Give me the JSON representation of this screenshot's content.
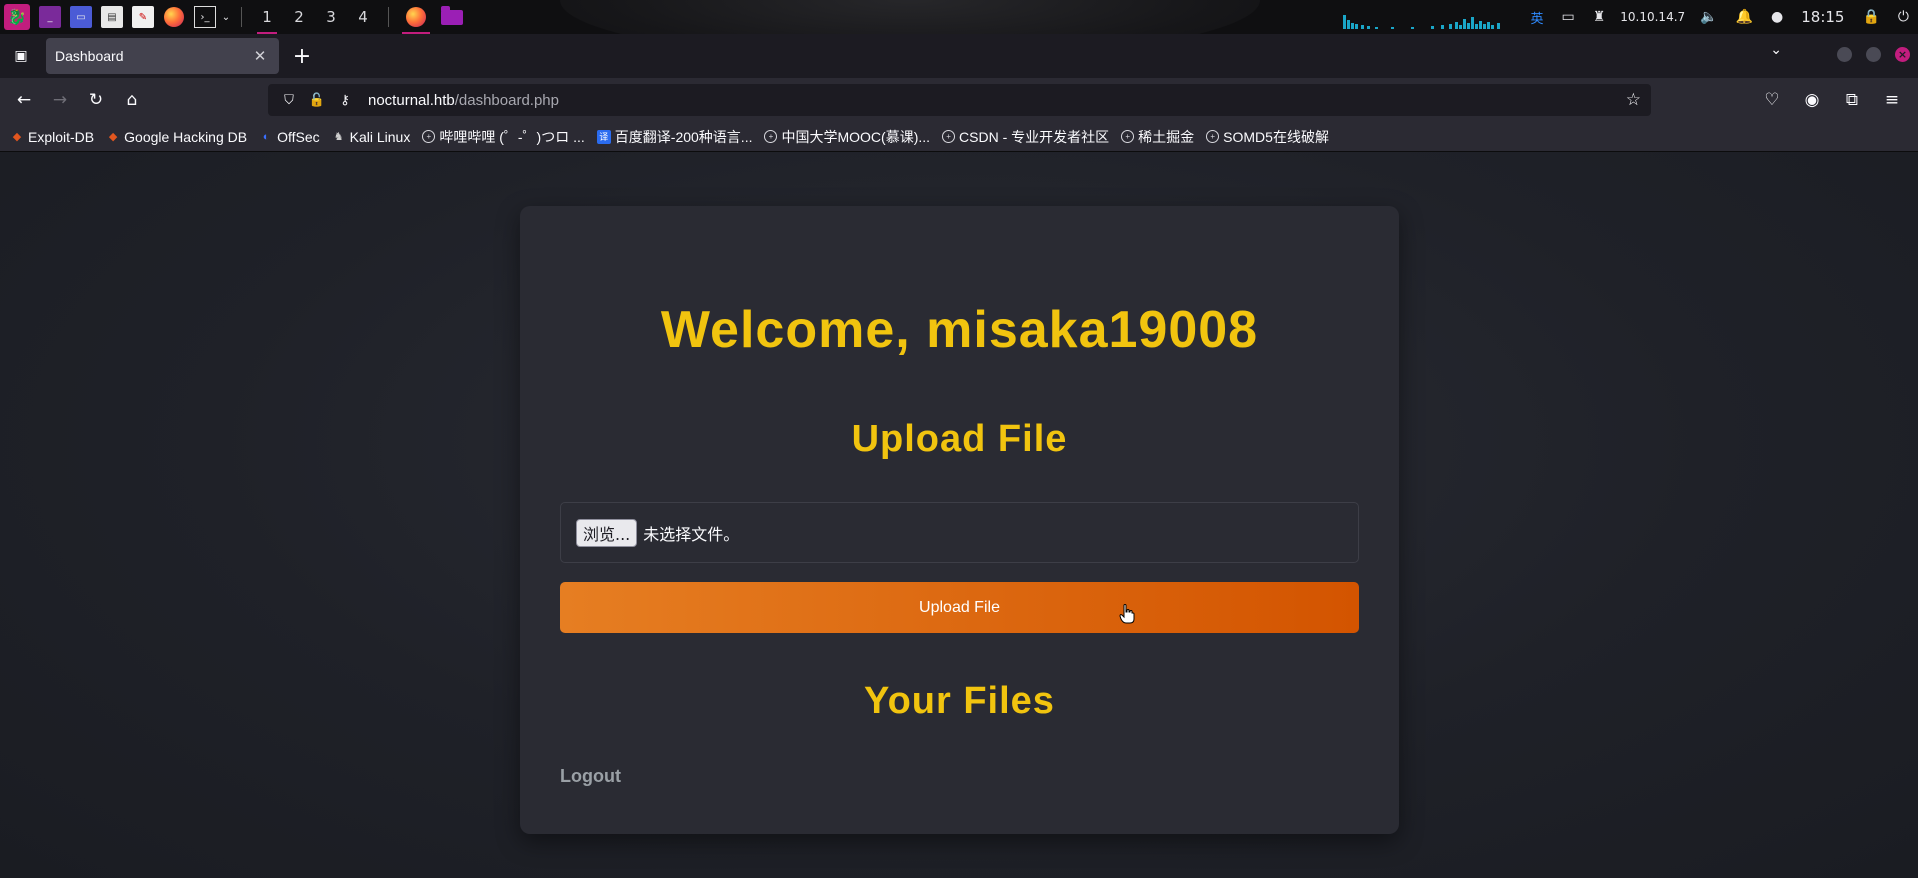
{
  "taskbar": {
    "workspaces": [
      "1",
      "2",
      "3",
      "4"
    ],
    "active_workspace": "1",
    "language": "英",
    "ip": "10.10.14.7",
    "clock": "18:15",
    "accent_color": "#c21d7e"
  },
  "browser": {
    "tab_title": "Dashboard",
    "url_host": "nocturnal.htb",
    "url_path": "/dashboard.php",
    "bookmarks": [
      {
        "label": "Exploit-DB",
        "icon": "flame-icon"
      },
      {
        "label": "Google Hacking DB",
        "icon": "flame-icon"
      },
      {
        "label": "OffSec",
        "icon": "offsec-icon"
      },
      {
        "label": "Kali Linux",
        "icon": "kali-icon"
      },
      {
        "label": "哔哩哔哩 (゜-゜)つロ ...",
        "icon": "globe-icon"
      },
      {
        "label": "百度翻译-200种语言...",
        "icon": "translate-icon"
      },
      {
        "label": "中国大学MOOC(慕课)...",
        "icon": "globe-icon"
      },
      {
        "label": "CSDN - 专业开发者社区",
        "icon": "globe-icon"
      },
      {
        "label": "稀土掘金",
        "icon": "globe-icon"
      },
      {
        "label": "SOMD5在线破解",
        "icon": "globe-icon"
      }
    ]
  },
  "page": {
    "welcome": "Welcome, misaka19008",
    "upload_heading": "Upload File",
    "browse_label": "浏览...",
    "no_file_text": "未选择文件。",
    "upload_button": "Upload File",
    "files_heading": "Your Files",
    "logout": "Logout",
    "heading_color": "#f1c40f",
    "button_color": "#e67e22"
  }
}
